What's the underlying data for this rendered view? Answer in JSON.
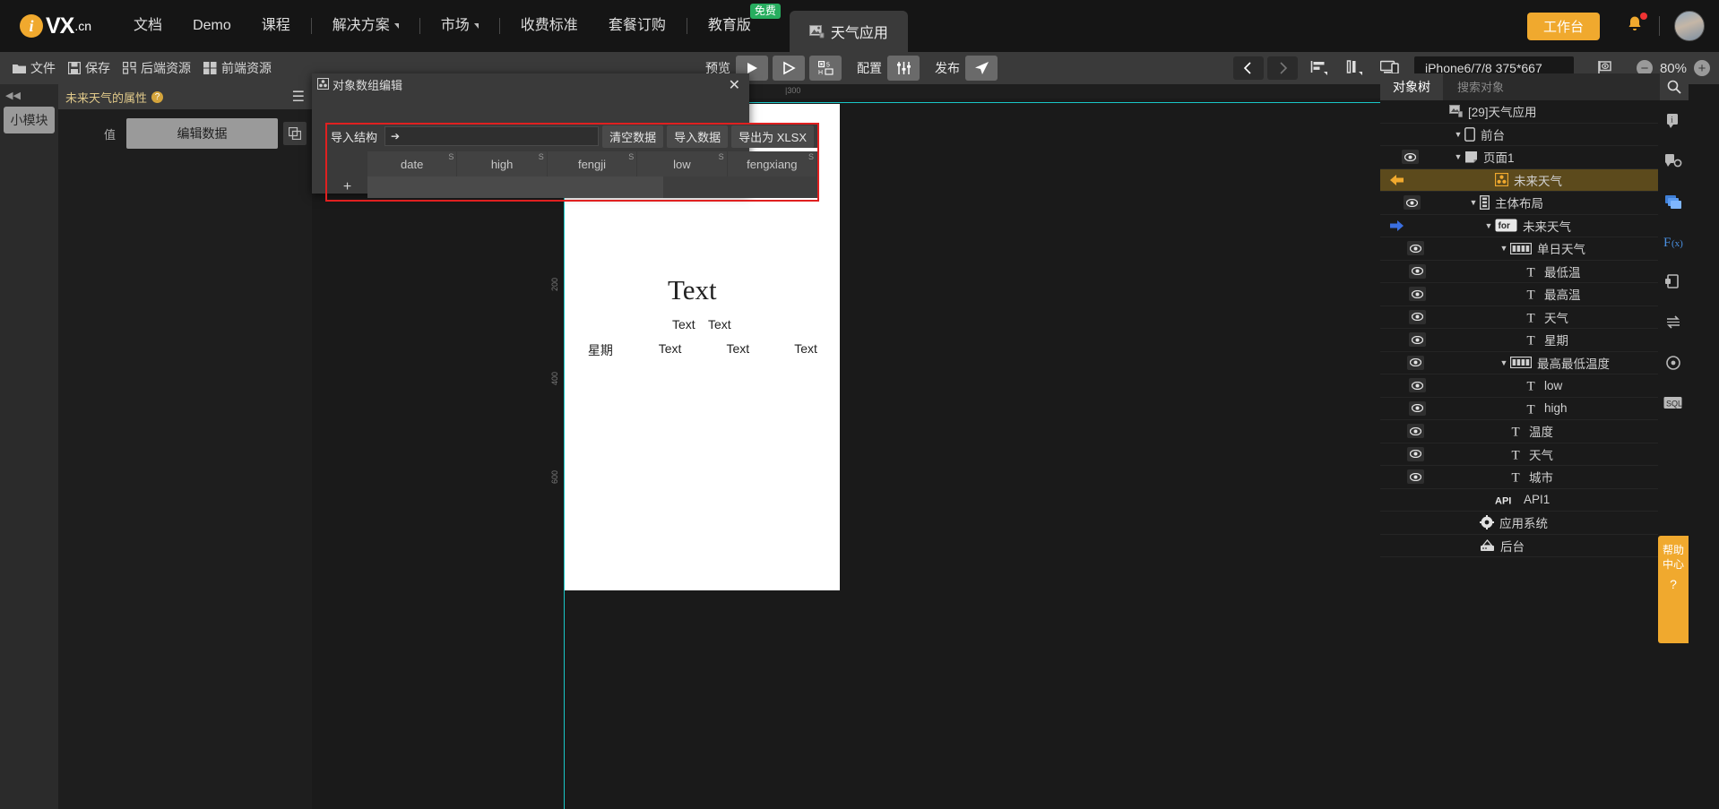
{
  "topnav": {
    "logo": {
      "mark": "i",
      "name": "VX",
      "suffix": ".cn"
    },
    "items": [
      {
        "label": "文档",
        "caret": false,
        "sep_after": false
      },
      {
        "label": "Demo",
        "caret": false,
        "sep_after": false
      },
      {
        "label": "课程",
        "caret": false,
        "sep_after": true
      },
      {
        "label": "解决方案",
        "caret": true,
        "sep_after": true
      },
      {
        "label": "市场",
        "caret": true,
        "sep_after": true
      },
      {
        "label": "收费标准",
        "caret": false,
        "sep_after": false
      },
      {
        "label": "套餐订购",
        "caret": false,
        "sep_after": true
      },
      {
        "label": "教育版",
        "caret": false,
        "sep_after": false,
        "badge": "免费"
      }
    ],
    "app_tab": {
      "label": "天气应用",
      "icon": "image-app-icon"
    },
    "workbench_button": "工作台",
    "notification_icon": "bell-icon",
    "avatar": "user-avatar"
  },
  "toolbar": {
    "left_items": [
      {
        "label": "文件",
        "icon": "folder-icon"
      },
      {
        "label": "保存",
        "icon": "save-icon"
      },
      {
        "label": "后端资源",
        "icon": "backend-icon"
      },
      {
        "label": "前端资源",
        "icon": "frontend-icon"
      }
    ],
    "preview_label": "预览",
    "play_icon": "play-icon",
    "play2_icon": "play-outline-icon",
    "h5_icon": "h5-qrcode-icon",
    "config_label": "配置",
    "config_icon": "sliders-icon",
    "publish_label": "发布",
    "publish_icon": "send-icon",
    "prev_icon": "chevron-left-icon",
    "next_icon": "chevron-right-icon",
    "align_icon": "align-horizontal-icon",
    "distribute_icon": "distribute-vertical-icon",
    "device_icon": "device-preview-icon",
    "device_value": "iPhone6/7/8 375*667",
    "eye_icon": "visibility-flag-icon",
    "zoom_out": "−",
    "zoom_value": "80%",
    "zoom_in": "+"
  },
  "leftrail": {
    "collapse_icon": "collapse-left-icon",
    "mini_module": "小模块"
  },
  "properties": {
    "title": "未来天气的属性",
    "help": "?",
    "menu_icon": "hamburger-icon",
    "value_label": "值",
    "edit_data_button": "编辑数据",
    "copy_icon": "copy-icon"
  },
  "modal": {
    "title": "对象数组编辑",
    "title_icon": "object-array-icon",
    "close_icon": "close-icon",
    "import_structure_label": "导入结构",
    "import_structure_value": "",
    "cursor_icon": "cursor-icon",
    "buttons": [
      "清空数据",
      "导入数据",
      "导出为 XLSX"
    ],
    "columns": [
      {
        "name": "date",
        "type": "S"
      },
      {
        "name": "high",
        "type": "S"
      },
      {
        "name": "fengji",
        "type": "S"
      },
      {
        "name": "low",
        "type": "S"
      },
      {
        "name": "fengxiang",
        "type": "S"
      }
    ],
    "add_row_icon": "+",
    "rows": []
  },
  "canvas": {
    "ruler_top_ticks": [
      "|300"
    ],
    "ruler_left_ticks": [
      "200",
      "400",
      "600"
    ],
    "phone": {
      "big_text": "Text",
      "sub_text_1": "Text",
      "sub_text_2": "Text",
      "row": [
        {
          "label": "星期"
        },
        {
          "label": "Text"
        },
        {
          "label": "Text"
        },
        {
          "label": "Text"
        }
      ]
    }
  },
  "rightpanel": {
    "tab_label": "对象树",
    "search_placeholder": "搜索对象",
    "search_value": "",
    "search_icon": "search-icon",
    "tree": [
      {
        "label": "[29]天气应用",
        "indent": 1,
        "icon": "app-icon",
        "eye": false,
        "twisty": "",
        "selected": false,
        "badge": false,
        "info": false,
        "arrow": ""
      },
      {
        "label": "前台",
        "indent": 2,
        "icon": "mobile-icon",
        "eye": false,
        "twisty": "▼",
        "selected": false,
        "badge": false,
        "info": false,
        "arrow": ""
      },
      {
        "label": "页面1",
        "indent": 2,
        "icon": "page-icon",
        "eye": true,
        "twisty": "▼",
        "selected": false,
        "badge": false,
        "info": true,
        "arrow": ""
      },
      {
        "label": "未来天气",
        "indent": 4,
        "icon": "object-array-icon",
        "eye": false,
        "twisty": "",
        "selected": true,
        "badge": true,
        "info": false,
        "arrow": "back"
      },
      {
        "label": "主体布局",
        "indent": 3,
        "icon": "layout-icon",
        "eye": true,
        "twisty": "▼",
        "selected": false,
        "badge": false,
        "info": false,
        "arrow": ""
      },
      {
        "label": "未来天气",
        "indent": 4,
        "icon": "for-icon",
        "eye": false,
        "twisty": "▼",
        "selected": false,
        "badge": false,
        "info": false,
        "arrow": "forward"
      },
      {
        "label": "单日天气",
        "indent": 5,
        "icon": "container-icon",
        "eye": true,
        "twisty": "▼",
        "selected": false,
        "badge": false,
        "info": false,
        "arrow": ""
      },
      {
        "label": "最低温",
        "indent": 6,
        "icon": "text-icon",
        "eye": true,
        "twisty": "",
        "selected": false,
        "badge": false,
        "info": false,
        "arrow": ""
      },
      {
        "label": "最高温",
        "indent": 6,
        "icon": "text-icon",
        "eye": true,
        "twisty": "",
        "selected": false,
        "badge": false,
        "info": false,
        "arrow": ""
      },
      {
        "label": "天气",
        "indent": 6,
        "icon": "text-icon",
        "eye": true,
        "twisty": "",
        "selected": false,
        "badge": false,
        "info": false,
        "arrow": ""
      },
      {
        "label": "星期",
        "indent": 6,
        "icon": "text-icon",
        "eye": true,
        "twisty": "",
        "selected": false,
        "badge": false,
        "info": false,
        "arrow": ""
      },
      {
        "label": "最高最低温度",
        "indent": 5,
        "icon": "container-icon",
        "eye": true,
        "twisty": "▼",
        "selected": false,
        "badge": false,
        "info": false,
        "arrow": ""
      },
      {
        "label": "low",
        "indent": 6,
        "icon": "text-icon",
        "eye": true,
        "twisty": "",
        "selected": false,
        "badge": true,
        "info": false,
        "arrow": ""
      },
      {
        "label": "high",
        "indent": 6,
        "icon": "text-icon",
        "eye": true,
        "twisty": "",
        "selected": false,
        "badge": true,
        "info": false,
        "arrow": ""
      },
      {
        "label": "温度",
        "indent": 5,
        "icon": "text-icon",
        "eye": true,
        "twisty": "",
        "selected": false,
        "badge": true,
        "info": false,
        "arrow": ""
      },
      {
        "label": "天气",
        "indent": 5,
        "icon": "text-icon",
        "eye": true,
        "twisty": "",
        "selected": false,
        "badge": true,
        "info": false,
        "arrow": ""
      },
      {
        "label": "城市",
        "indent": 5,
        "icon": "text-icon",
        "eye": true,
        "twisty": "",
        "selected": false,
        "badge": true,
        "info": false,
        "arrow": ""
      },
      {
        "label": "API1",
        "indent": 4,
        "icon": "api-icon",
        "eye": false,
        "twisty": "",
        "selected": false,
        "badge": true,
        "info": false,
        "arrow": ""
      },
      {
        "label": "应用系统",
        "indent": 3,
        "icon": "gear-icon",
        "eye": false,
        "twisty": "",
        "selected": false,
        "badge": false,
        "info": false,
        "arrow": ""
      },
      {
        "label": "后台",
        "indent": 3,
        "icon": "backend-tree-icon",
        "eye": false,
        "twisty": "",
        "selected": false,
        "badge": false,
        "info": false,
        "arrow": ""
      }
    ],
    "rail_icons": [
      "info-icon",
      "component-settings-icon",
      "layers-icon",
      "function-icon",
      "export-icon",
      "sync-icon",
      "target-icon",
      "sql-icon"
    ],
    "help_float": {
      "line1": "帮助",
      "line2": "中心",
      "mark": "?"
    }
  },
  "colors": {
    "accent_orange": "#f0a92e",
    "green_badge": "#27ad5f",
    "selection": "#5c4a1c",
    "guide": "#19c7c7",
    "red_highlight": "#e02020"
  }
}
